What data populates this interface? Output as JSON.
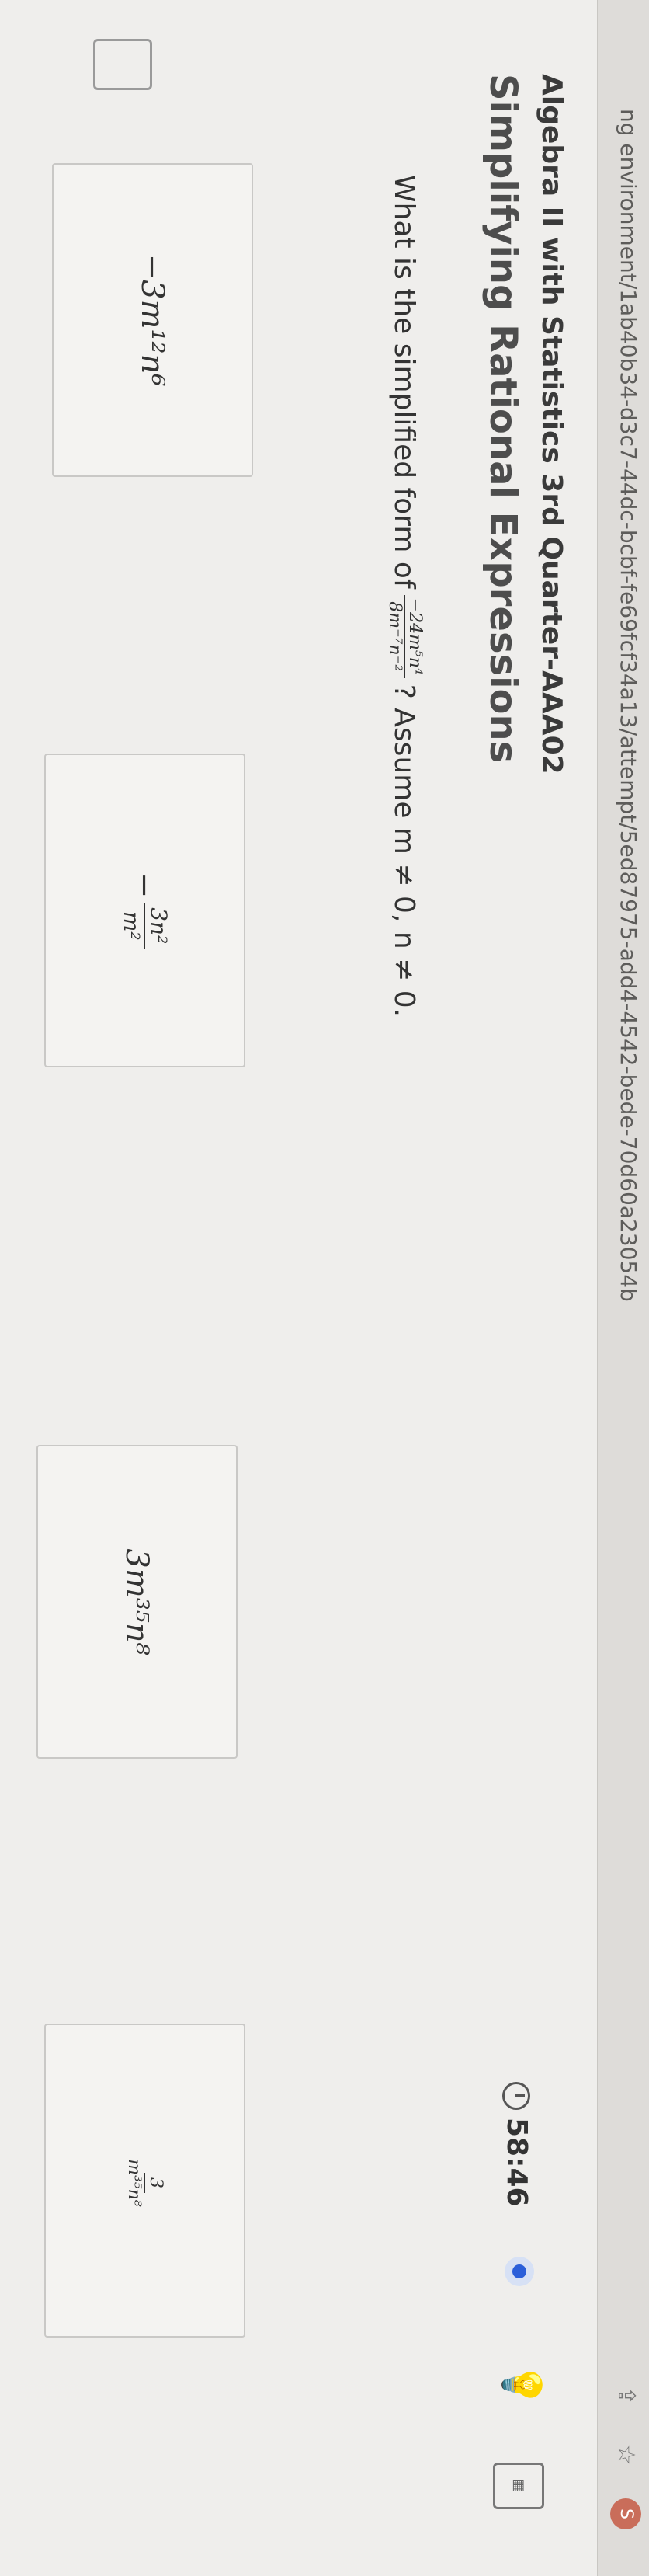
{
  "browser": {
    "url": "ng environment/1ab40b34-d3c7-44dc-bcbf-fe69fcf34a13/attempt/5ed87975-add4-4542-bede-70d60a23054b",
    "profile_initial": "S"
  },
  "header": {
    "course_title": "Algebra II with Statistics 3rd Quarter-AAA02",
    "lesson_title": "Simplifying Rational Expressions",
    "timer": "58:46"
  },
  "question": {
    "prefix": "What is the simplified form of",
    "numerator": "−24m⁵n⁴",
    "denominator": "8m⁻⁷n⁻²",
    "suffix": "? Assume m ≠ 0, n ≠ 0."
  },
  "options": [
    {
      "id": "a",
      "text": "−3m¹²n⁶"
    },
    {
      "id": "b",
      "sign": "−",
      "numerator": "3n²",
      "denominator": "m²"
    },
    {
      "id": "c",
      "text": "3m³⁵n⁸"
    },
    {
      "id": "d",
      "numerator": "3",
      "denominator": "m³⁵n⁸"
    }
  ],
  "icons": {
    "timer": "clock-icon",
    "hint": "lightbulb-icon",
    "calculator": "calculator-icon"
  },
  "colors": {
    "accent": "#2b5fd9",
    "text": "#333333",
    "card_border": "#c9c8c6"
  }
}
